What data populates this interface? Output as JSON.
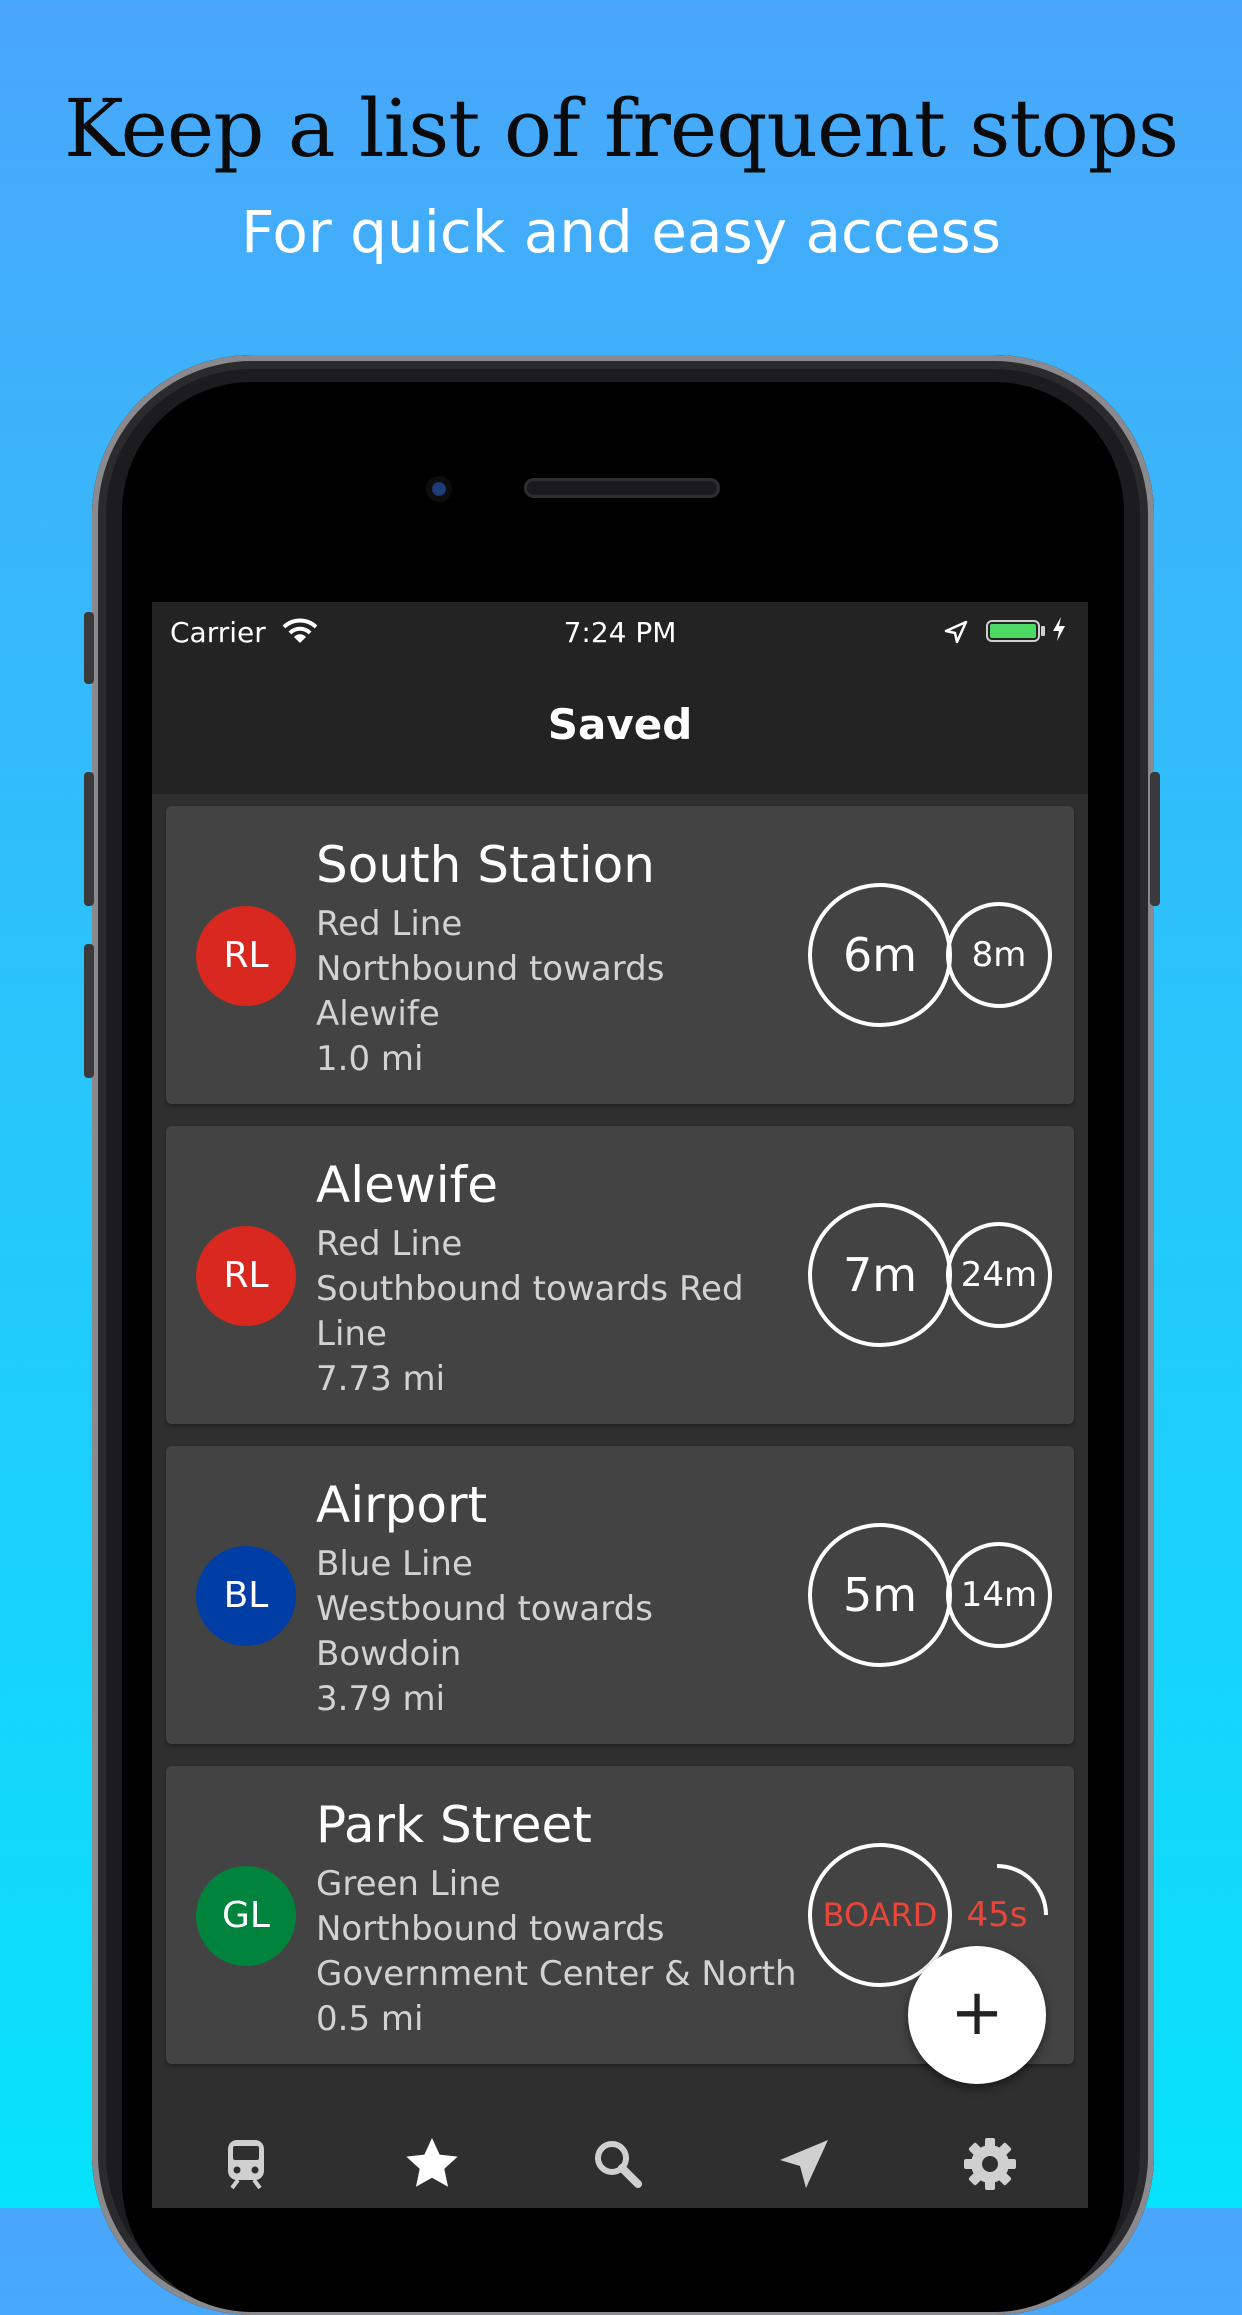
{
  "marketing": {
    "headline": "Keep a list of frequent stops",
    "subline": "For quick and easy access"
  },
  "status_bar": {
    "carrier": "Carrier",
    "time": "7:24 PM",
    "battery_color": "#4cd964",
    "icons": [
      "wifi-icon",
      "location-arrow-icon",
      "battery-icon",
      "charging-bolt-icon"
    ]
  },
  "nav": {
    "title": "Saved"
  },
  "stops": [
    {
      "name": "South Station",
      "badge": "RL",
      "badge_color": "#d9281f",
      "line": "Red Line",
      "direction_1": "Northbound towards",
      "direction_2": "Alewife",
      "distance": "1.0 mi",
      "next": "6m",
      "after": "8m"
    },
    {
      "name": "Alewife",
      "badge": "RL",
      "badge_color": "#d9281f",
      "line": "Red Line",
      "direction_1": "Southbound towards Red",
      "direction_2": "Line",
      "distance": "7.73 mi",
      "next": "7m",
      "after": "24m"
    },
    {
      "name": "Airport",
      "badge": "BL",
      "badge_color": "#003da5",
      "line": "Blue Line",
      "direction_1": "Westbound towards",
      "direction_2": "Bowdoin",
      "distance": "3.79 mi",
      "next": "5m",
      "after": "14m"
    },
    {
      "name": "Park Street",
      "badge": "GL",
      "badge_color": "#00843d",
      "line": "Green Line",
      "direction_1": "Northbound towards",
      "direction_2": "Government Center & North",
      "distance": "0.5 mi",
      "next": "BOARD",
      "after": "45s",
      "alert_color": "#e8463a"
    }
  ],
  "fab": {
    "label": "+"
  },
  "tabs": [
    {
      "icon": "train-icon"
    },
    {
      "icon": "star-icon",
      "active": true
    },
    {
      "icon": "search-icon"
    },
    {
      "icon": "location-arrow-icon"
    },
    {
      "icon": "gear-icon"
    }
  ]
}
